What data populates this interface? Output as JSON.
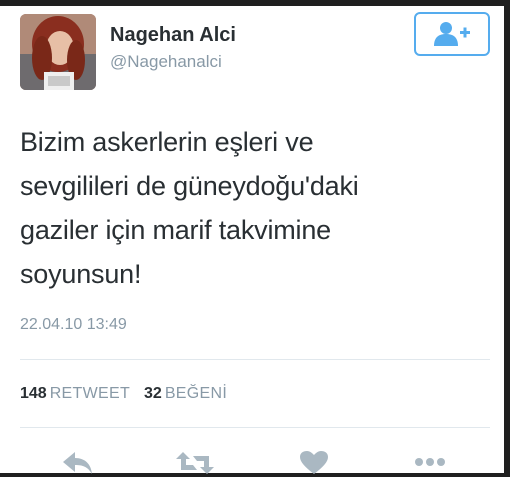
{
  "user": {
    "display_name": "Nagehan Alci",
    "handle": "@Nagehanalci"
  },
  "follow_button": {
    "icon": "follow-person-plus-icon"
  },
  "tweet": {
    "lines": [
      "Bizim askerlerin eşleri ve",
      "sevgilileri de güneydoğu'daki",
      "gaziler için marif takvimine",
      "soyunsun!"
    ],
    "timestamp": "22.04.10 13:49"
  },
  "stats": {
    "retweets_count": "148",
    "retweets_label": "RETWEET",
    "likes_count": "32",
    "likes_label": "BEĞENİ"
  },
  "actions": {
    "reply_icon": "reply-icon",
    "retweet_icon": "retweet-icon",
    "like_icon": "heart-icon",
    "more_icon": "more-icon"
  },
  "colors": {
    "accent": "#55acee",
    "text": "#292f33",
    "muted": "#8899a6",
    "divider": "#e1e8ed",
    "icon": "#aab8c2"
  }
}
